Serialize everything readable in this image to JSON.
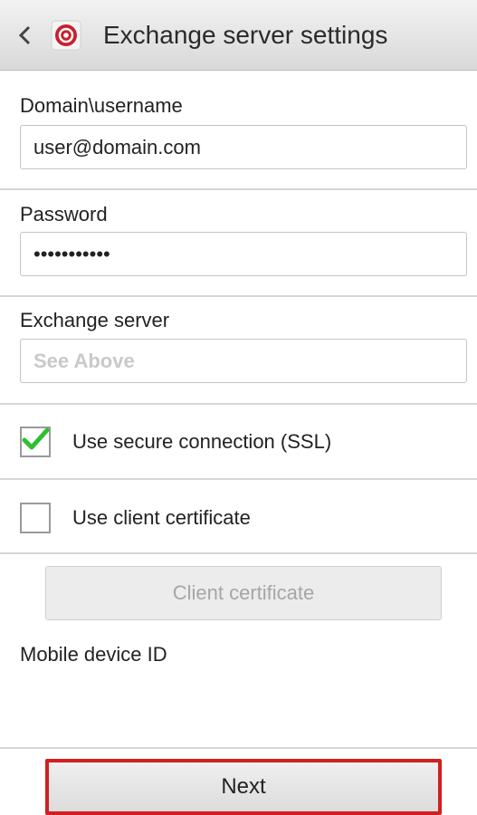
{
  "header": {
    "back_icon": "chevron-left-icon",
    "app_icon": "email-at-icon",
    "title": "Exchange server settings"
  },
  "form": {
    "username": {
      "label": "Domain\\username",
      "value": "user@domain.com"
    },
    "password": {
      "label": "Password",
      "value": "•••••••••••"
    },
    "server": {
      "label": "Exchange server",
      "placeholder": "See Above",
      "value": ""
    },
    "ssl": {
      "label": "Use secure connection (SSL)",
      "checked": true
    },
    "client_cert_checkbox": {
      "label": "Use client certificate",
      "checked": false
    },
    "client_cert_button": "Client certificate",
    "device_id_label": "Mobile device ID"
  },
  "footer": {
    "next_label": "Next"
  },
  "colors": {
    "accent_check": "#2fbf2f",
    "highlight_border": "#d21f1f",
    "icon_red": "#c8202b"
  }
}
